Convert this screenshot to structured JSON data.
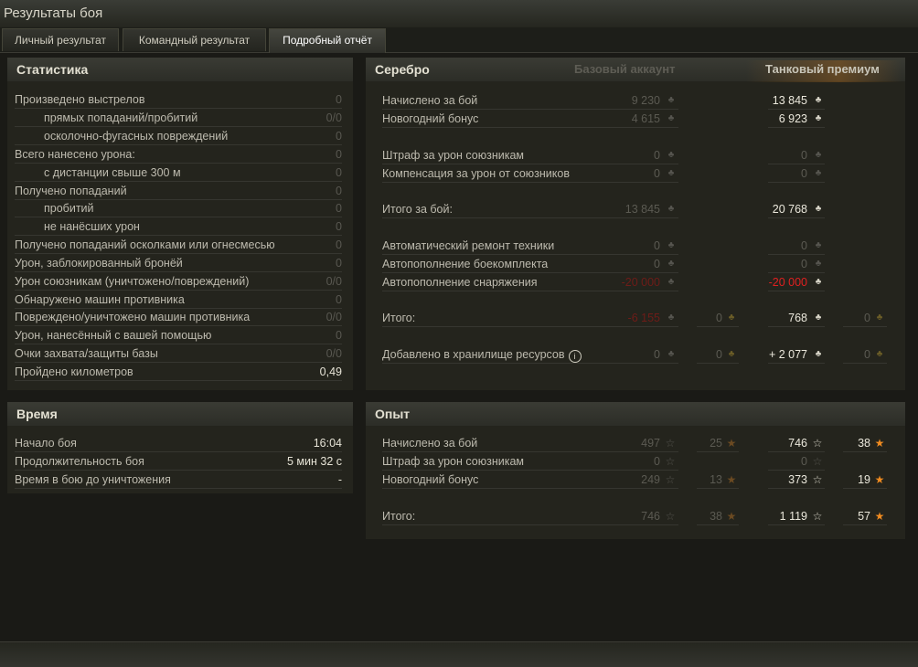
{
  "window": {
    "title": "Результаты боя"
  },
  "tabs": [
    "Личный результат",
    "Командный результат",
    "Подробный отчёт"
  ],
  "stats": {
    "title": "Статистика",
    "rows": [
      {
        "label": "Произведено выстрелов",
        "value": "0"
      },
      {
        "label": "прямых попаданий/пробитий",
        "value": "0/0"
      },
      {
        "label": "осколочно-фугасных повреждений",
        "value": "0"
      },
      {
        "label": "Всего нанесено урона:",
        "value": "0"
      },
      {
        "label": "с дистанции свыше 300 м",
        "value": "0"
      },
      {
        "label": "Получено попаданий",
        "value": "0"
      },
      {
        "label": "пробитий",
        "value": "0"
      },
      {
        "label": "не нанёсших урон",
        "value": "0"
      },
      {
        "label": "Получено попаданий осколками или огнесмесью",
        "value": "0"
      },
      {
        "label": "Урон, заблокированный бронёй",
        "value": "0"
      },
      {
        "label": "Урон союзникам (уничтожено/повреждений)",
        "value": "0/0"
      },
      {
        "label": "Обнаружено машин противника",
        "value": "0"
      },
      {
        "label": "Повреждено/уничтожено машин противника",
        "value": "0/0"
      },
      {
        "label": "Урон, нанесённый с вашей помощью",
        "value": "0"
      },
      {
        "label": "Очки захвата/защиты базы",
        "value": "0/0"
      },
      {
        "label": "Пройдено километров",
        "value": "0,49"
      }
    ]
  },
  "time": {
    "title": "Время",
    "rows": [
      {
        "label": "Начало боя",
        "value": "16:04"
      },
      {
        "label": "Продолжительность боя",
        "value": "5 мин 32 с"
      },
      {
        "label": "Время в бою до уничтожения",
        "value": "-"
      }
    ]
  },
  "silver": {
    "title": "Серебро",
    "col_basic": "Базовый аккаунт",
    "col_premium": "Танковый премиум",
    "rows": [
      {
        "label": "Начислено за бой",
        "basic": "9 230",
        "premium": "13 845"
      },
      {
        "label": "Новогодний бонус",
        "basic": "4 615",
        "premium": "6 923"
      },
      {
        "label": "Штраф за урон союзникам",
        "basic": "0",
        "premium": "0"
      },
      {
        "label": "Компенсация за урон от союзников",
        "basic": "0",
        "premium": "0"
      },
      {
        "label": "Итого за бой:",
        "basic": "13 845",
        "premium": "20 768"
      },
      {
        "label": "Автоматический ремонт техники",
        "basic": "0",
        "premium": "0"
      },
      {
        "label": "Автопополнение боекомплекта",
        "basic": "0",
        "premium": "0"
      },
      {
        "label": "Автопополнение снаряжения",
        "basic": "-20 000",
        "premium": "-20 000"
      },
      {
        "label": "Итого:",
        "basic": "-6 155",
        "basic_gold": "0",
        "premium": "768",
        "premium_gold": "0"
      },
      {
        "label": "Добавлено в хранилище ресурсов",
        "basic": "0",
        "basic_gold": "0",
        "premium": "+ 2 077",
        "premium_gold": "0"
      }
    ]
  },
  "exp": {
    "title": "Опыт",
    "rows": [
      {
        "label": "Начислено за бой",
        "basic": "497",
        "basic_free": "25",
        "premium": "746",
        "premium_free": "38"
      },
      {
        "label": "Штраф за урон союзникам",
        "basic": "0",
        "premium": "0"
      },
      {
        "label": "Новогодний бонус",
        "basic": "249",
        "basic_free": "13",
        "premium": "373",
        "premium_free": "19"
      },
      {
        "label": "Итого:",
        "basic": "746",
        "basic_free": "38",
        "premium": "1 119",
        "premium_free": "57"
      }
    ]
  },
  "icons": {
    "credit": "credits-icon",
    "gold": "gold-icon",
    "star": "experience-star-icon",
    "free_star": "free-experience-star-icon",
    "info": "info-icon"
  },
  "colors": {
    "premium_header": "#f0a03a",
    "negative": "#e02020",
    "free_exp": "#f08b20"
  }
}
